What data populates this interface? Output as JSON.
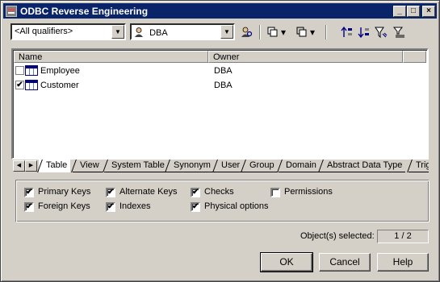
{
  "window": {
    "title": "ODBC Reverse Engineering",
    "minimize": "_",
    "maximize": "□",
    "close": "×"
  },
  "toolbar": {
    "qualifier": "<All qualifiers>",
    "owner": "DBA",
    "owner_icon": "user-icon",
    "combo_arrow": "▼",
    "dropdown_glyph": "▾"
  },
  "list": {
    "columns": [
      "Name",
      "Owner"
    ],
    "rows": [
      {
        "name": "Employee",
        "owner": "DBA",
        "checked": false
      },
      {
        "name": "Customer",
        "owner": "DBA",
        "checked": true
      }
    ]
  },
  "tabs": {
    "scroll_left": "◀",
    "scroll_right": "▶",
    "items": [
      "Table",
      "View",
      "System Table",
      "Synonym",
      "User",
      "Group",
      "Domain",
      "Abstract Data Type",
      "Trig"
    ]
  },
  "options": {
    "primary_keys": {
      "label": "Primary Keys",
      "checked": true
    },
    "foreign_keys": {
      "label": "Foreign Keys",
      "checked": true
    },
    "alternate_keys": {
      "label": "Alternate Keys",
      "checked": true
    },
    "indexes": {
      "label": "Indexes",
      "checked": true
    },
    "checks": {
      "label": "Checks",
      "checked": true
    },
    "physical_options": {
      "label": "Physical options",
      "checked": true
    },
    "permissions": {
      "label": "Permissions",
      "checked": false
    }
  },
  "status": {
    "label": "Object(s) selected:",
    "value": "1 / 2"
  },
  "buttons": {
    "ok": "OK",
    "cancel": "Cancel",
    "help": "Help"
  },
  "check_glyph": "✔"
}
